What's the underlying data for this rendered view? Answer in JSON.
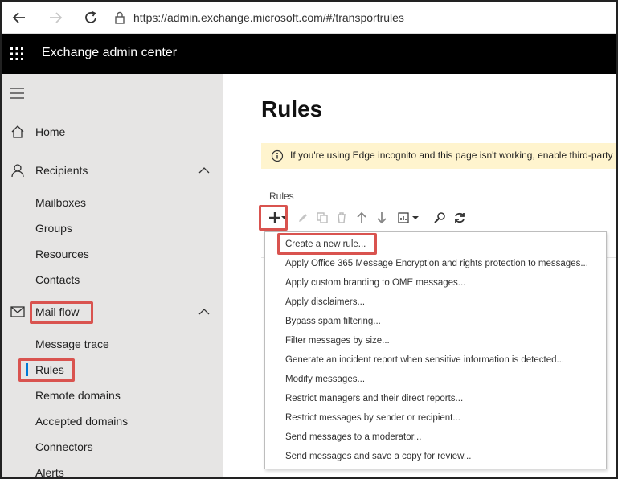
{
  "browser": {
    "url": "https://admin.exchange.microsoft.com/#/transportrules"
  },
  "app": {
    "title": "Exchange admin center"
  },
  "sidebar": {
    "items": [
      {
        "label": "Home",
        "icon": "home-icon"
      },
      {
        "label": "Recipients",
        "icon": "person-icon",
        "expanded": true
      },
      {
        "label": "Mailboxes"
      },
      {
        "label": "Groups"
      },
      {
        "label": "Resources"
      },
      {
        "label": "Contacts"
      },
      {
        "label": "Mail flow",
        "icon": "mail-icon",
        "expanded": true
      },
      {
        "label": "Message trace"
      },
      {
        "label": "Rules",
        "selected": true
      },
      {
        "label": "Remote domains"
      },
      {
        "label": "Accepted domains"
      },
      {
        "label": "Connectors"
      },
      {
        "label": "Alerts"
      }
    ]
  },
  "main": {
    "title": "Rules",
    "info_text": "If you're using Edge incognito and this page isn't working, enable third-party",
    "section_label": "Rules"
  },
  "menu": {
    "items": [
      "Create a new rule...",
      "Apply Office 365 Message Encryption and rights protection to messages...",
      "Apply custom branding to OME messages...",
      "Apply disclaimers...",
      "Bypass spam filtering...",
      "Filter messages by size...",
      "Generate an incident report when sensitive information is detected...",
      "Modify messages...",
      "Restrict managers and their direct reports...",
      "Restrict messages by sender or recipient...",
      "Send messages to a moderator...",
      "Send messages and save a copy for review..."
    ]
  },
  "colors": {
    "accent": "#0078d4",
    "highlight": "#d9534f",
    "info_background": "#fff4ce",
    "sidebar_background": "#e6e5e4",
    "header_background": "#000000"
  }
}
